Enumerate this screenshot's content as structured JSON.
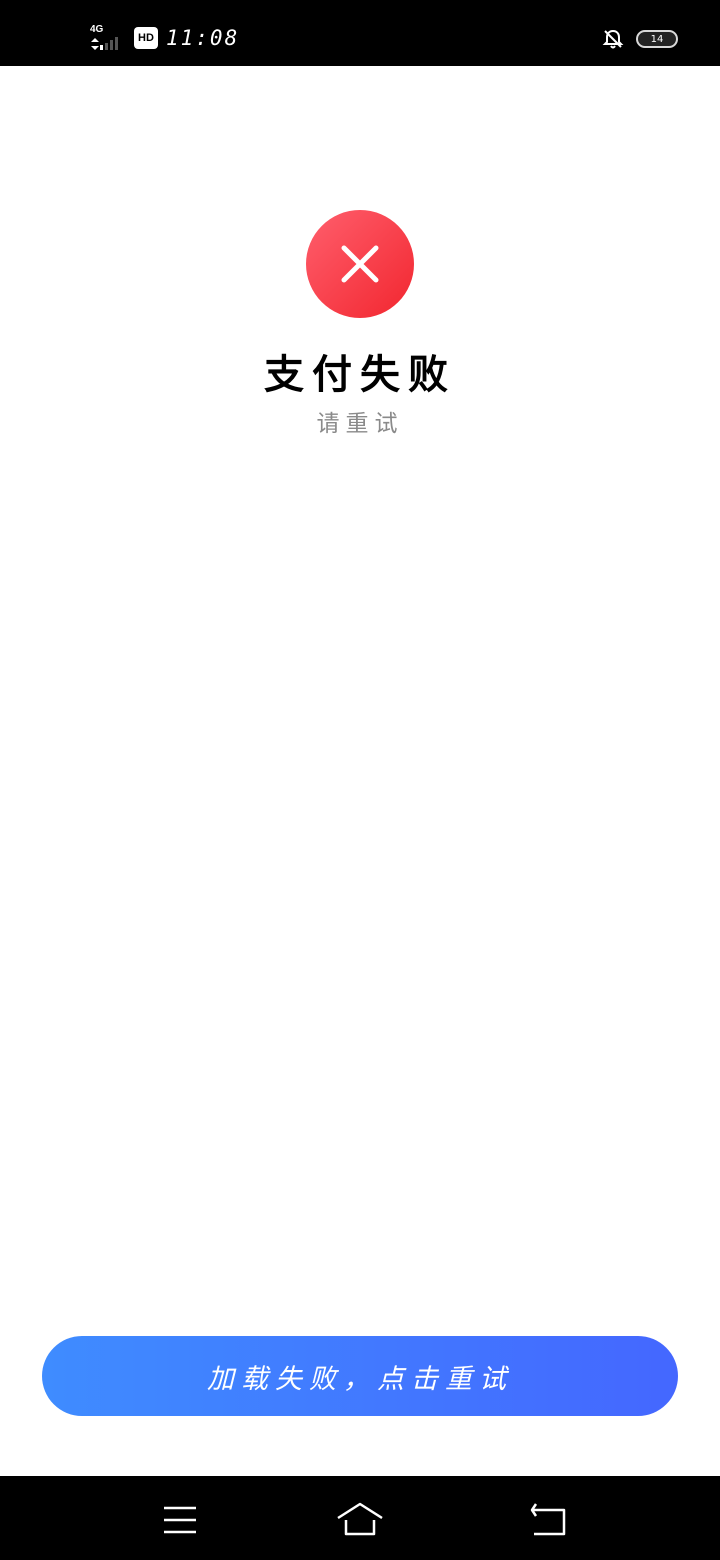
{
  "status_bar": {
    "network": "4G",
    "hd_badge": "HD",
    "time": "11:08",
    "battery": "14",
    "icons": [
      "signal-icon",
      "bell-off-icon",
      "battery-icon"
    ]
  },
  "result": {
    "icon": "close-icon",
    "title": "支付失败",
    "subtitle": "请重试"
  },
  "retry": {
    "label": "加载失败，点击重试"
  },
  "nav_bar": {
    "icons": [
      "menu-icon",
      "home-icon",
      "back-icon"
    ]
  },
  "colors": {
    "error_red": "#f2262f",
    "button_blue_start": "#3f8cff",
    "button_blue_end": "#4467ff",
    "subtitle_gray": "#8a8a8a"
  }
}
